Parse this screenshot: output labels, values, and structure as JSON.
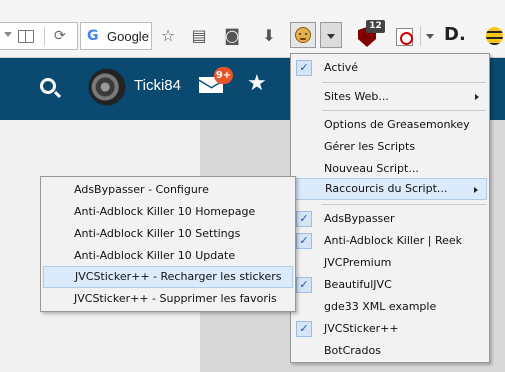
{
  "toolbar": {
    "search_engine_label": "Google",
    "ublock_badge": "12",
    "d_logo": "D."
  },
  "site_header": {
    "username": "Ticki84",
    "notifications_badge": "9+"
  },
  "greasemonkey_menu": {
    "items": [
      {
        "label": "Activé",
        "checked": true
      },
      {
        "label": "Sites Web...",
        "submenu": true
      },
      {
        "label": "Options de Greasemonkey"
      },
      {
        "label": "Gérer les Scripts"
      },
      {
        "label": "Nouveau Script..."
      },
      {
        "label": "Raccourcis du Script...",
        "submenu": true,
        "highlighted": true
      },
      {
        "label": "AdsBypasser",
        "checked": true
      },
      {
        "label": "Anti-Adblock Killer | Reek",
        "checked": true
      },
      {
        "label": "JVCPremium"
      },
      {
        "label": "BeautifulJVC",
        "checked": true
      },
      {
        "label": "gde33 XML example"
      },
      {
        "label": "JVCSticker++",
        "checked": true
      },
      {
        "label": "BotCrados"
      }
    ]
  },
  "script_shortcuts_submenu": {
    "items": [
      {
        "label": "AdsBypasser - Configure"
      },
      {
        "label": "Anti-Adblock Killer 10 Homepage"
      },
      {
        "label": "Anti-Adblock Killer 10 Settings"
      },
      {
        "label": "Anti-Adblock Killer 10 Update"
      },
      {
        "label": "JVCSticker++ - Recharger les stickers",
        "highlighted": true
      },
      {
        "label": "JVCSticker++ - Supprimer les favoris"
      }
    ]
  }
}
